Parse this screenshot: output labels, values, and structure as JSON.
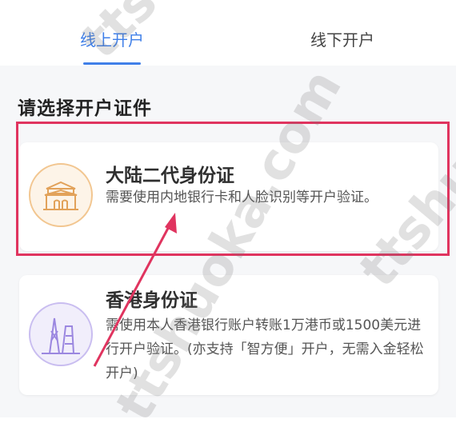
{
  "tabs": {
    "online": "线上开户",
    "offline": "线下开户"
  },
  "section_title": "请选择开户证件",
  "cards": [
    {
      "title": "大陆二代身份证",
      "description": "需要使用内地银行卡和人脸识别等开户验证。",
      "icon": "tiananmen-icon"
    },
    {
      "title": "香港身份证",
      "description": "需使用本人香港银行账户转账1万港币或1500美元进行开户验证。(亦支持「智方便」开户，无需入金轻松开户)",
      "icon": "hk-skyline-icon"
    }
  ],
  "watermark": {
    "top": "tts",
    "left": "ttshuoka.com",
    "right": "ttshu"
  },
  "colors": {
    "accent": "#3f7fe8",
    "highlight": "#e0345f",
    "arrow": "#e0345f"
  }
}
